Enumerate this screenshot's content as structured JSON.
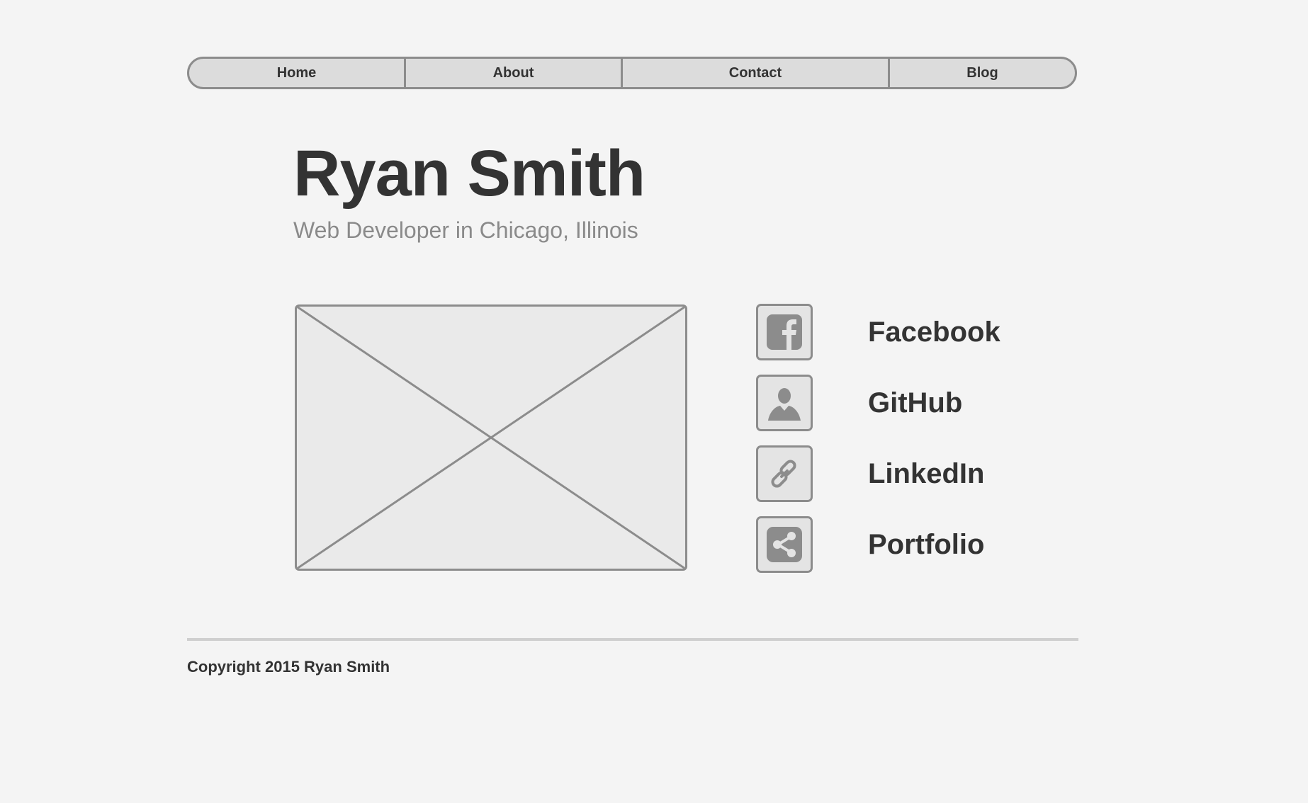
{
  "nav": {
    "items": [
      {
        "label": "Home"
      },
      {
        "label": "About"
      },
      {
        "label": "Contact"
      },
      {
        "label": "Blog"
      }
    ]
  },
  "header": {
    "title": "Ryan Smith",
    "subtitle": "Web Developer in Chicago, Illinois"
  },
  "main": {
    "image_placeholder": {
      "kind": "image-placeholder"
    },
    "social_links": [
      {
        "label": "Facebook",
        "icon": "facebook-icon"
      },
      {
        "label": "GitHub",
        "icon": "user-icon"
      },
      {
        "label": "LinkedIn",
        "icon": "link-icon"
      },
      {
        "label": "Portfolio",
        "icon": "share-icon"
      }
    ]
  },
  "footer": {
    "copyright": "Copyright 2015 Ryan Smith"
  },
  "colors": {
    "background": "#f4f4f4",
    "nav_fill": "#dcdcdc",
    "border": "#8c8c8c",
    "text": "#333333",
    "subtitle": "#8a8a8a",
    "rule": "#cfcfcf"
  }
}
